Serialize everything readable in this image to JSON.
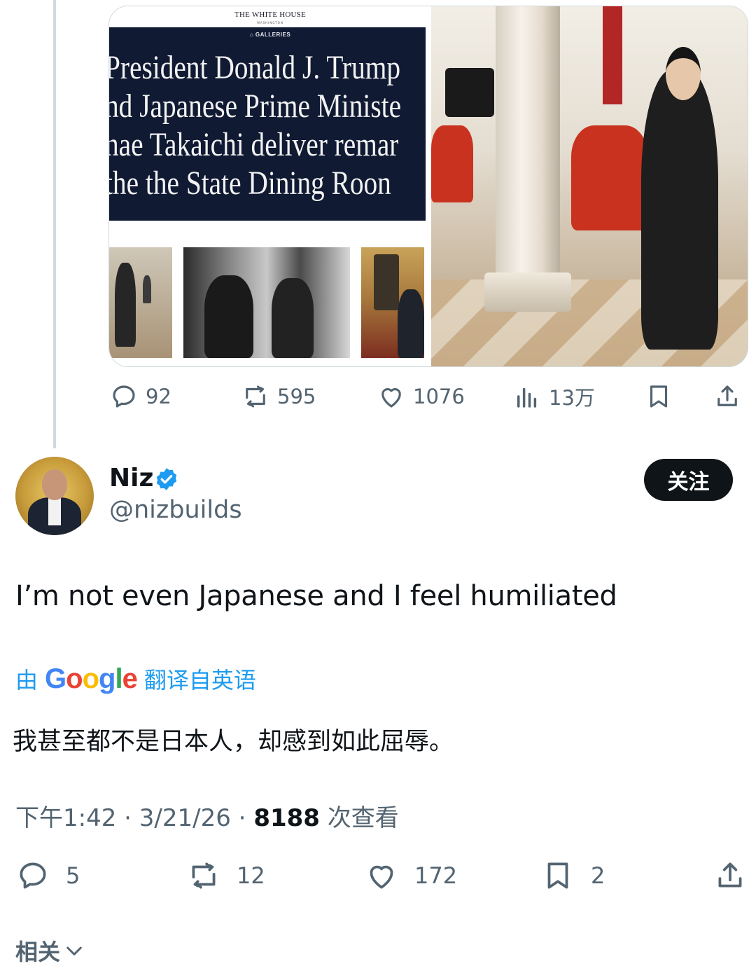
{
  "quoted_media": {
    "site_logo": "THE WHITE HOUSE",
    "site_logo_sub": "WASHINGTON",
    "section_label": "GALLERIES",
    "headline_lines": [
      "President Donald J. Trump",
      "nd Japanese Prime Ministe",
      "nae Takaichi deliver remar",
      "the the State Dining Roon"
    ]
  },
  "parent_stats": {
    "replies": "92",
    "reposts": "595",
    "likes": "1076",
    "views": "13万"
  },
  "tweet": {
    "author_name": "Niz",
    "handle": "@nizbuilds",
    "follow_label": "关注",
    "text": "I’m not even Japanese and I feel humiliated",
    "translate_prefix": "由",
    "translate_brand": "Google",
    "translate_suffix": "翻译自英语",
    "translated_text": "我甚至都不是日本人，却感到如此屈辱。",
    "time": "下午1:42",
    "date": "3/21/26",
    "views_count": "8188",
    "views_label": "次查看"
  },
  "tweet_stats": {
    "replies": "5",
    "reposts": "12",
    "likes": "172",
    "bookmarks": "2"
  },
  "related_label": "相关",
  "colors": {
    "accent": "#1d9bf0",
    "muted": "#536471",
    "text": "#0f1419",
    "banner": "#101a33"
  },
  "icons": [
    "reply-icon",
    "repost-icon",
    "like-icon",
    "views-icon",
    "bookmark-icon",
    "share-icon",
    "verified-badge-icon",
    "chevron-down-icon"
  ]
}
